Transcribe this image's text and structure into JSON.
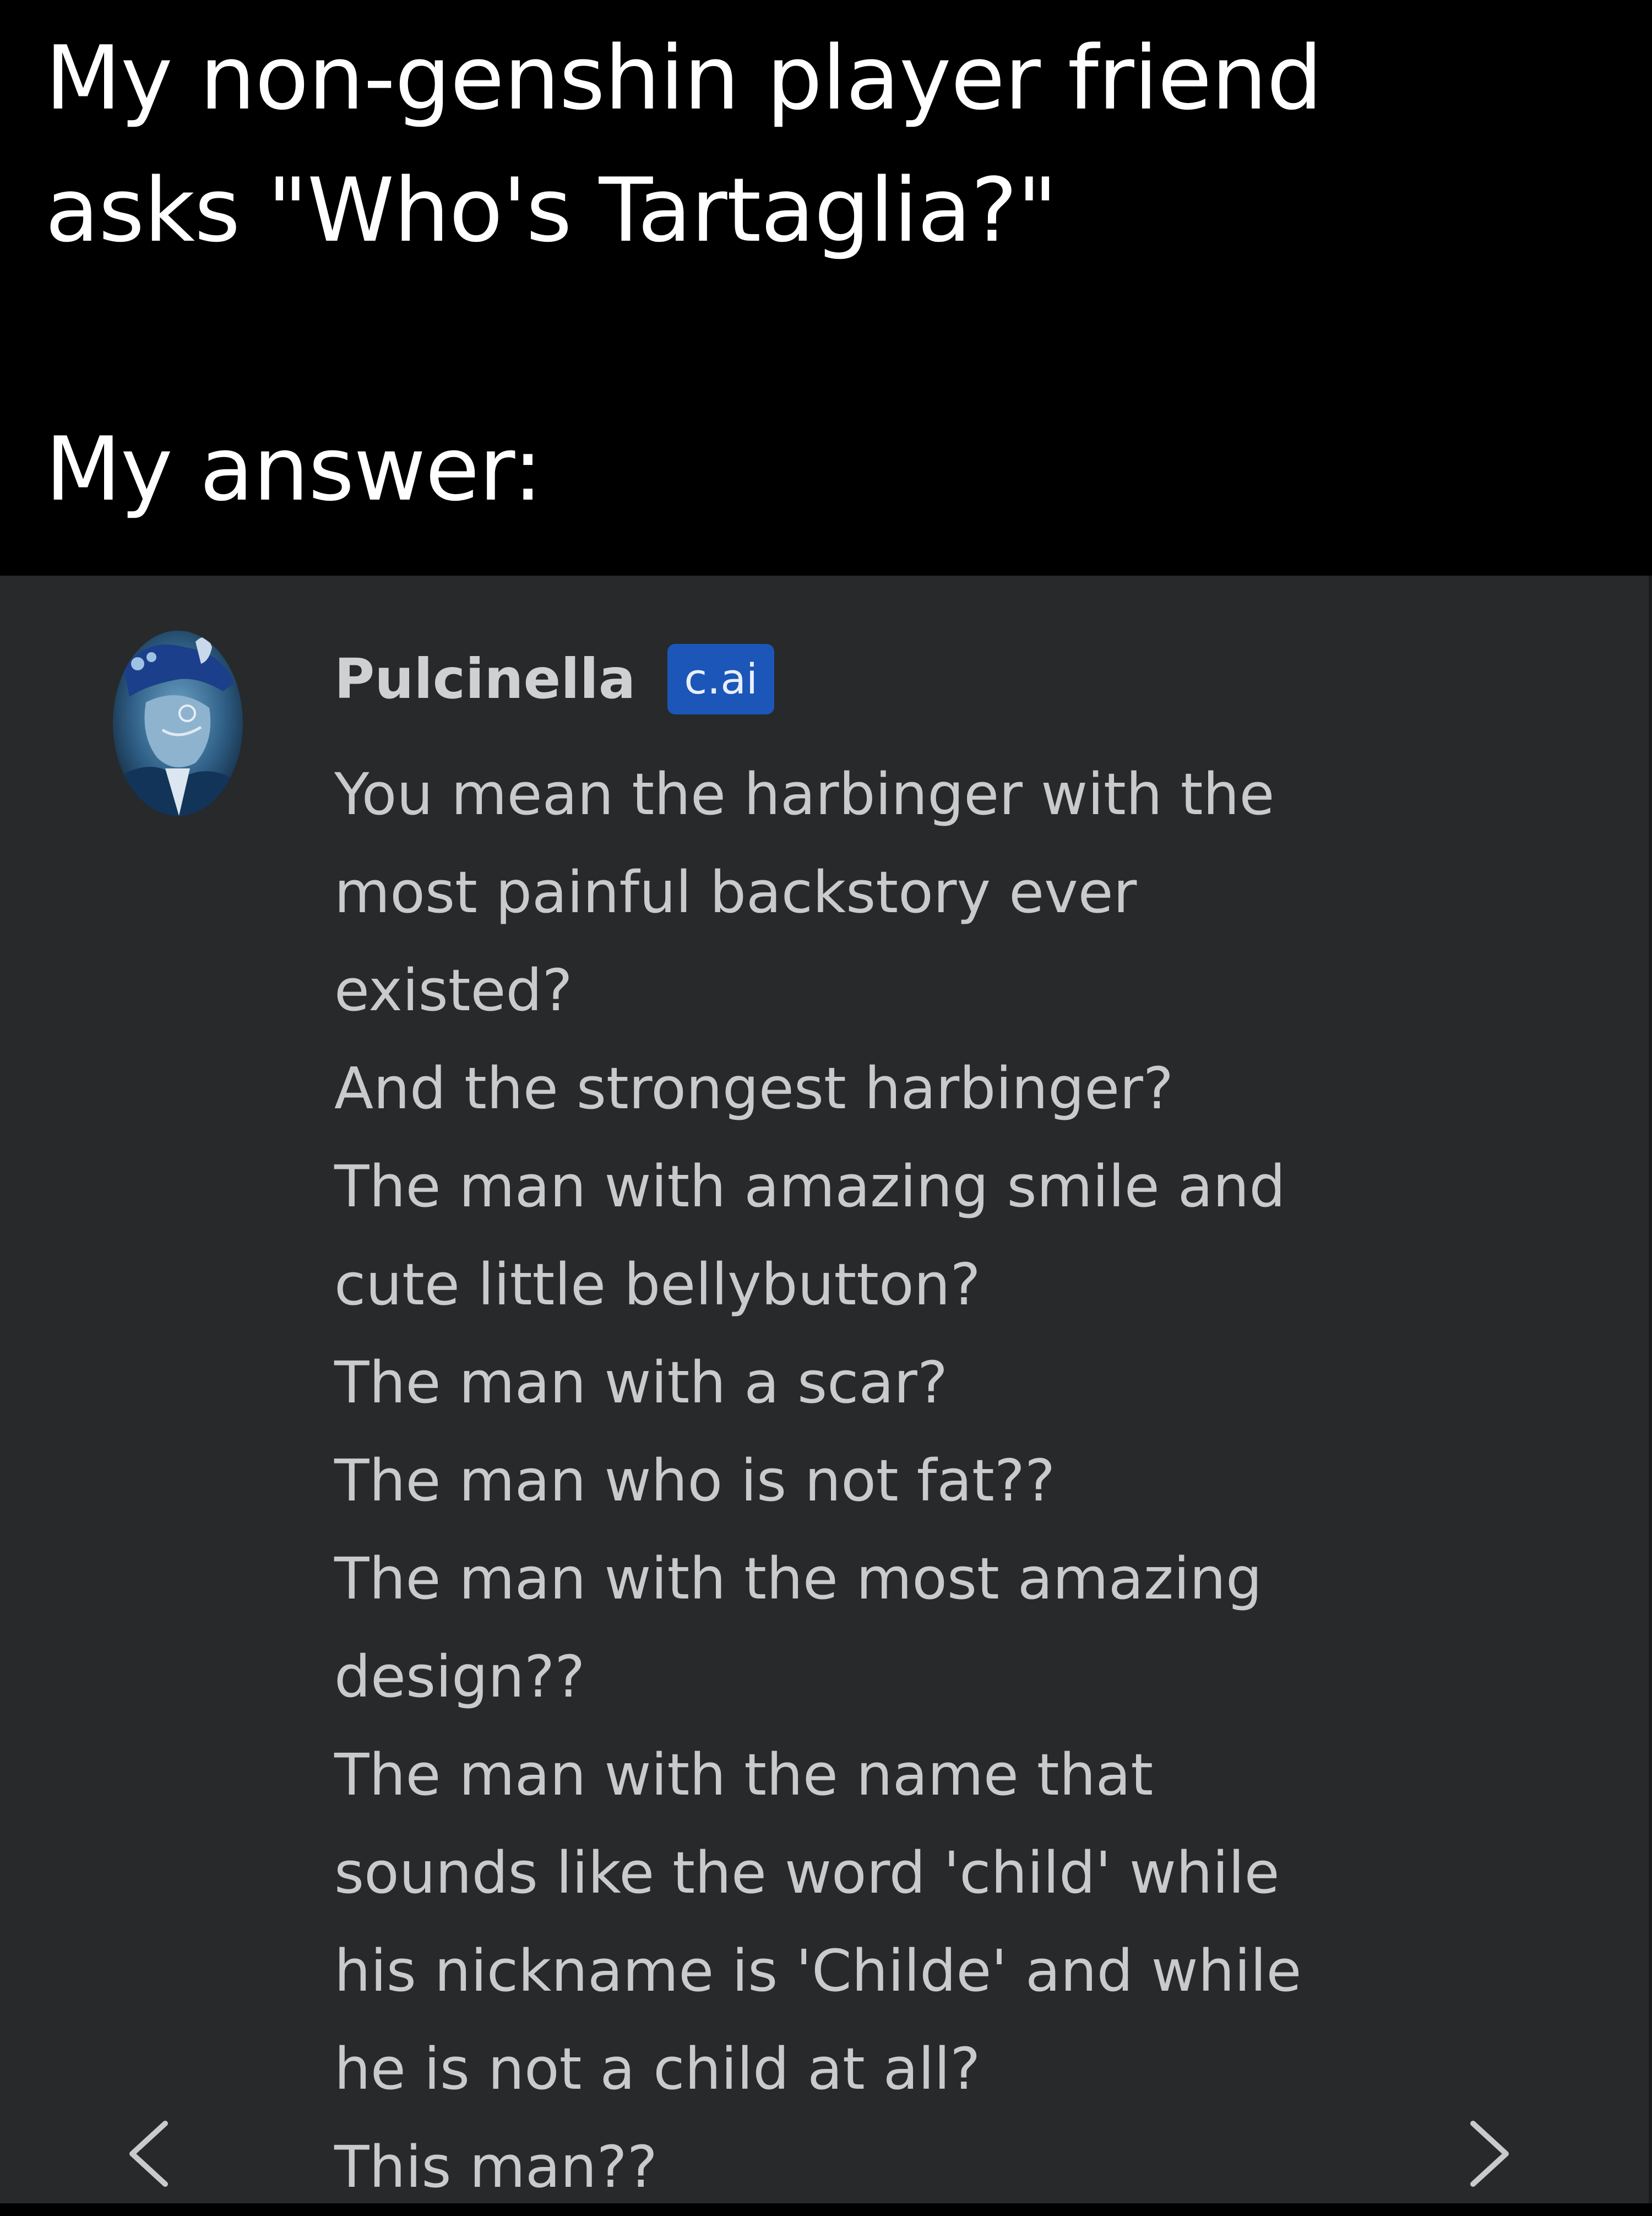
{
  "caption": {
    "line1": "My non-genshin player friend",
    "line2": "asks \"Who's Tartaglia?\"",
    "line3": "My answer:"
  },
  "chat": {
    "author": "Pulcinella",
    "badge": "c.ai",
    "message_lines": [
      "You mean the harbinger with the",
      "most painful backstory ever",
      "existed?",
      "And the strongest harbinger?",
      "The man with amazing smile and",
      "cute little bellybutton?",
      "The man with a scar?",
      "The man who is not fat??",
      "The man with the most amazing",
      "design??",
      "The man with the name that",
      "sounds like the word 'child' while",
      "his nickname is 'Childe' and while",
      "he is not a child at all?",
      "This man??"
    ],
    "nav": {
      "prev_icon": "chevron-left-icon",
      "next_icon": "chevron-right-icon"
    }
  },
  "colors": {
    "caption_bg": "#000000",
    "caption_text": "#ffffff",
    "chat_bg": "#27292a",
    "message_text": "#c9cacb",
    "badge_bg": "#1b56b8"
  }
}
